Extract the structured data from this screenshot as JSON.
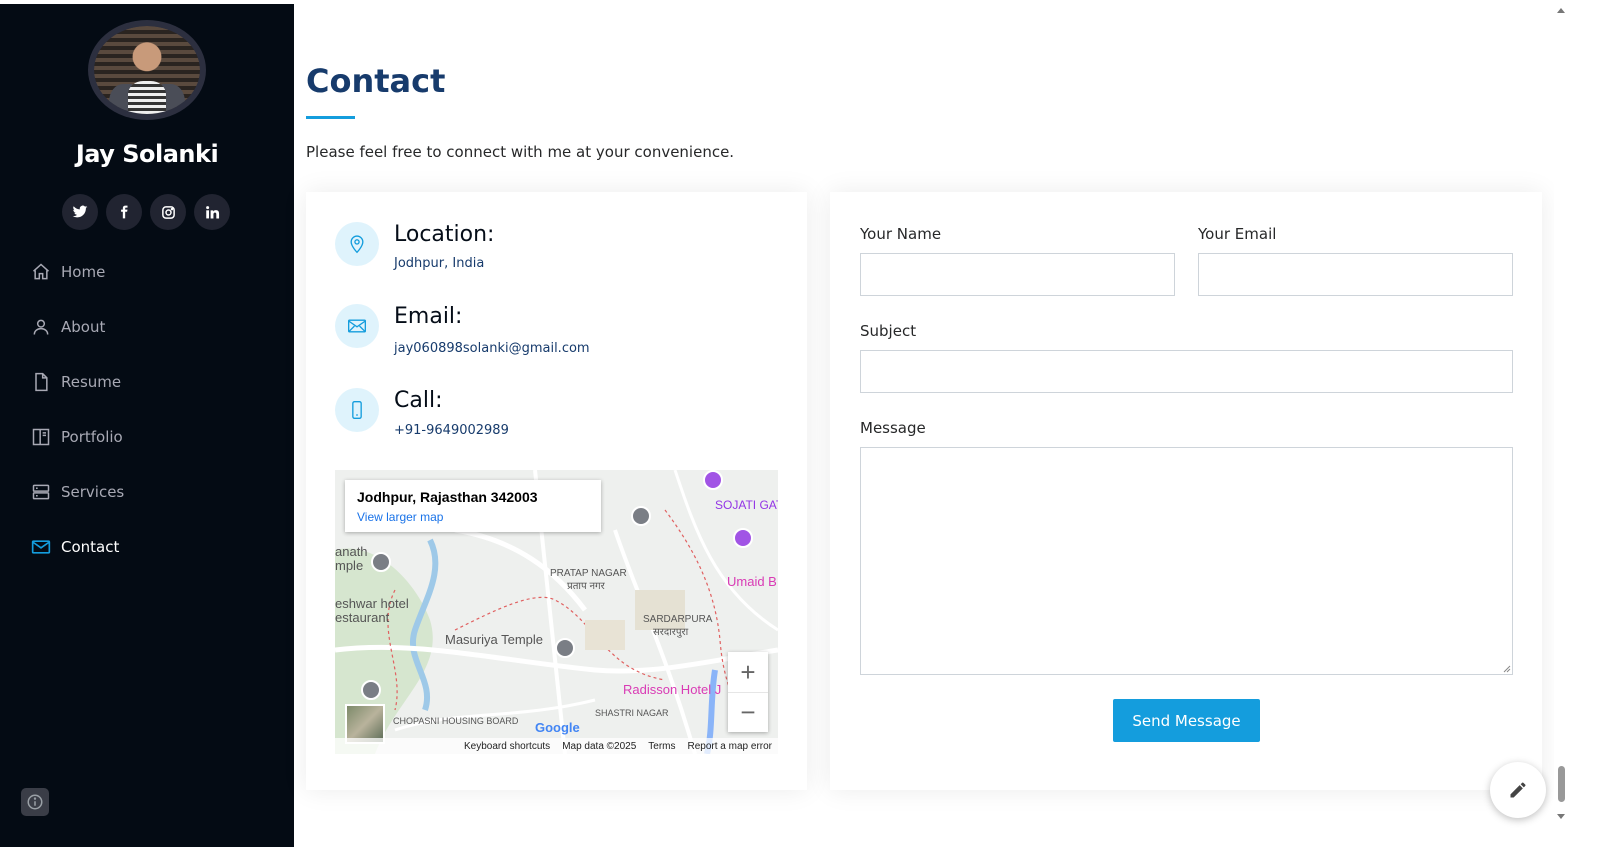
{
  "sidebar": {
    "name": "Jay Solanki",
    "social": [
      {
        "icon": "twitter-icon",
        "glyph": "🐦"
      },
      {
        "icon": "facebook-icon",
        "glyph": "f"
      },
      {
        "icon": "instagram-icon",
        "glyph": "◎"
      },
      {
        "icon": "linkedin-icon",
        "glyph": "in"
      }
    ],
    "nav": [
      {
        "label": "Home",
        "icon": "home-icon"
      },
      {
        "label": "About",
        "icon": "person-icon"
      },
      {
        "label": "Resume",
        "icon": "file-icon"
      },
      {
        "label": "Portfolio",
        "icon": "book-icon"
      },
      {
        "label": "Services",
        "icon": "server-icon"
      },
      {
        "label": "Contact",
        "icon": "envelope-icon",
        "active": true
      }
    ]
  },
  "section": {
    "title": "Contact",
    "lead": "Please feel free to connect with me at your convenience."
  },
  "info": {
    "location": {
      "title": "Location:",
      "value": "Jodhpur, India"
    },
    "email": {
      "title": "Email:",
      "value": "jay060898solanki@gmail.com"
    },
    "call": {
      "title": "Call:",
      "value": "+91-9649002989"
    }
  },
  "map": {
    "address": "Jodhpur, Rajasthan 342003",
    "link": "View larger map",
    "labels": [
      "PRATAP NAGAR",
      "प्रताप नगर",
      "SARDARPURA",
      "सरदारपुरा",
      "Masuriya Temple",
      "SOJATI GATE",
      "Umaid B",
      "Radisson Hotel J",
      "CHOPASNI HOUSING BOARD",
      "SHASTRI NAGAR",
      "eshwar hotel",
      "estaurant",
      "anath",
      "mple"
    ],
    "footer": [
      "Keyboard shortcuts",
      "Map data ©2025",
      "Terms",
      "Report a map error"
    ],
    "google": "Google"
  },
  "form": {
    "name_label": "Your Name",
    "email_label": "Your Email",
    "subject_label": "Subject",
    "message_label": "Message",
    "send_label": "Send Message"
  },
  "colors": {
    "accent": "#149ddd",
    "sidebar_bg": "#040b14",
    "title": "#173b6c"
  }
}
